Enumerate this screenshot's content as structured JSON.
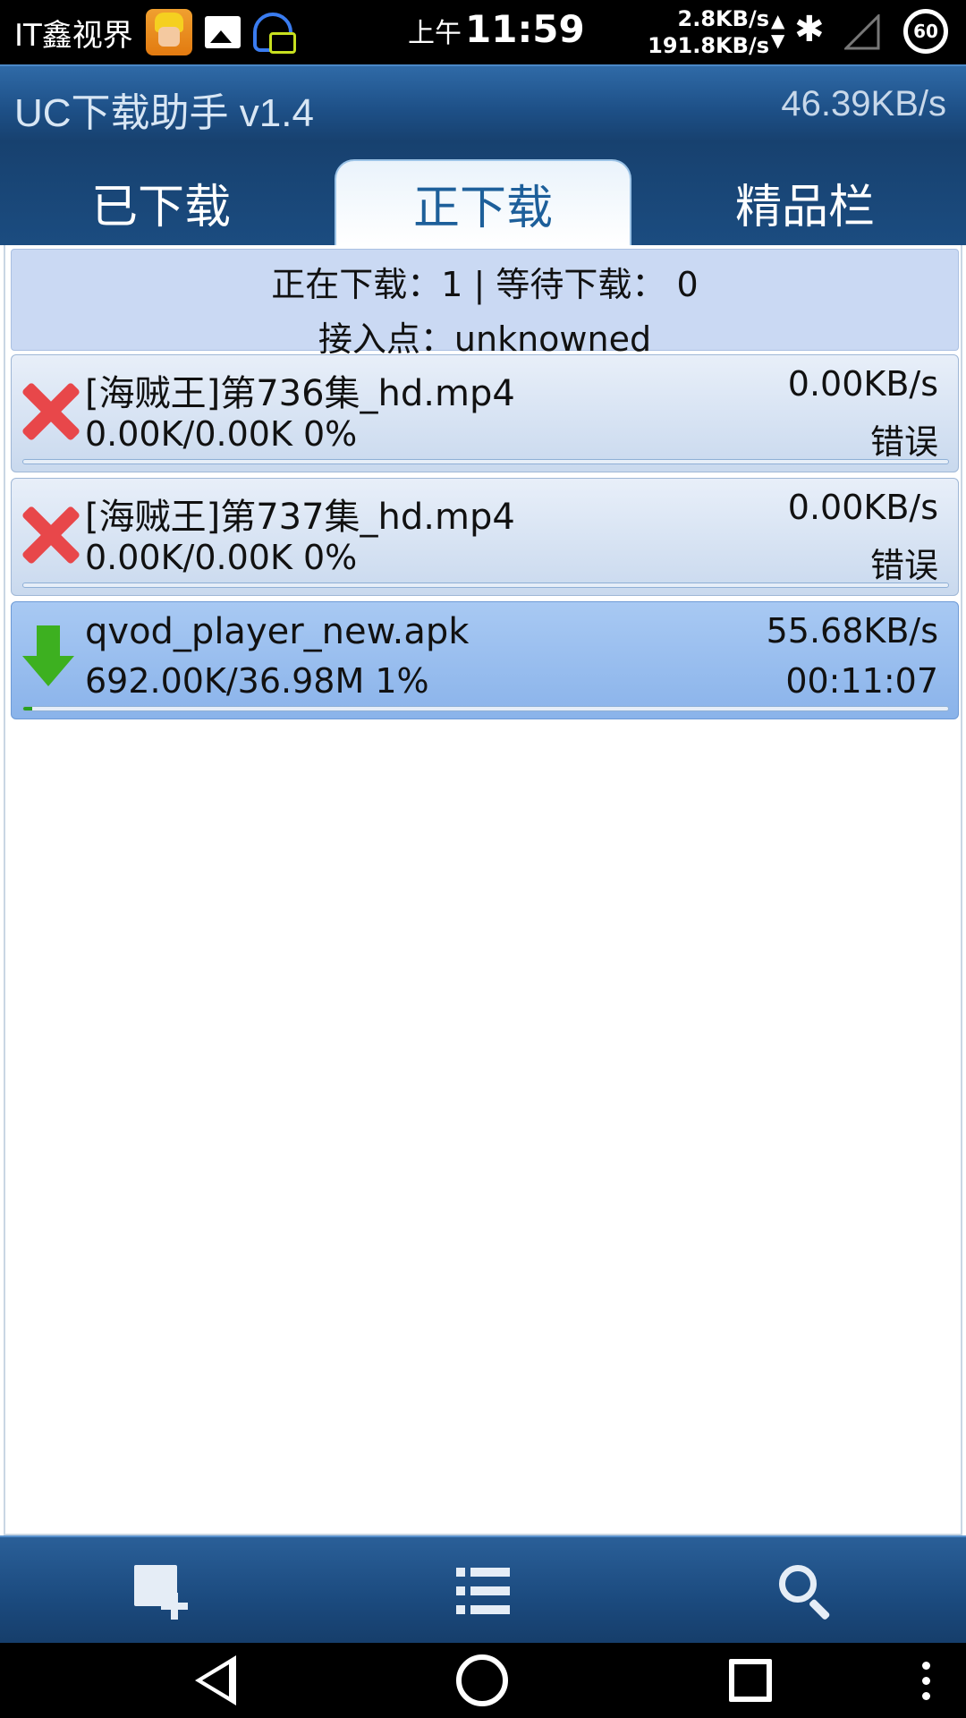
{
  "status_bar": {
    "carrier": "IT鑫视界",
    "ampm": "上午",
    "time": "11:59",
    "upload_speed": "2.8KB/s",
    "download_speed": "191.8KB/s",
    "battery": "60"
  },
  "app": {
    "title": "UC下载助手 v1.4",
    "total_speed": "46.39KB/s"
  },
  "tabs": [
    {
      "label": "已下载"
    },
    {
      "label": "正下载",
      "selected": true
    },
    {
      "label": "精品栏"
    }
  ],
  "info": {
    "line1": "正在下载：1 | 等待下载： 0",
    "line2": "接入点：unknowned"
  },
  "downloads": [
    {
      "name": "[海贼王]第736集_hd.mp4",
      "progress": "0.00K/0.00K  0%",
      "speed": "0.00KB/s",
      "status": "错误",
      "icon": "error-x-icon",
      "percent": 0
    },
    {
      "name": "[海贼王]第737集_hd.mp4",
      "progress": "0.00K/0.00K  0%",
      "speed": "0.00KB/s",
      "status": "错误",
      "icon": "error-x-icon",
      "percent": 0
    },
    {
      "name": "qvod_player_new.apk",
      "progress": "692.00K/36.98M  1%",
      "speed": "55.68KB/s",
      "status": "00:11:07",
      "icon": "download-arrow-icon",
      "percent": 1
    }
  ],
  "toolbar": {
    "icons": [
      "add-task-icon",
      "list-icon",
      "search-icon"
    ]
  },
  "colors": {
    "accent": "#1d4f86",
    "selected_tab_text": "#1d5f9a",
    "error_red": "#e8474a",
    "progress_green": "#2aa020"
  }
}
